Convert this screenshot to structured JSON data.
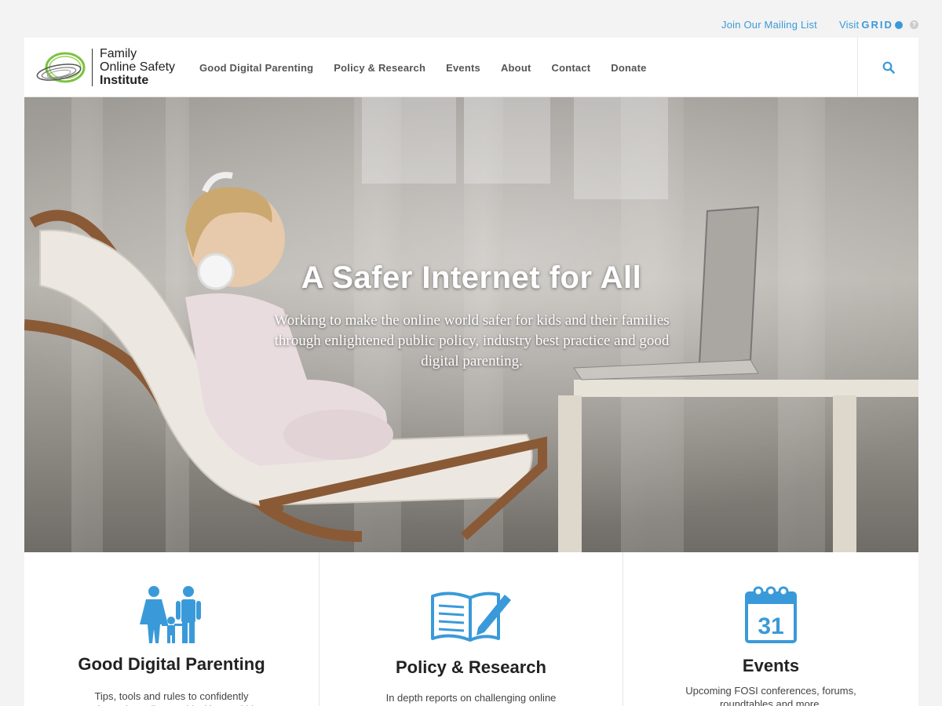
{
  "utility": {
    "mailing_label": "Join Our Mailing List",
    "visit_label": "Visit",
    "grid_label": "GRID",
    "help_label": "?"
  },
  "header": {
    "logo": {
      "line1": "Family",
      "line2": "Online Safety",
      "line3": "Institute"
    },
    "nav": [
      {
        "label": "Good Digital Parenting"
      },
      {
        "label": "Policy & Research"
      },
      {
        "label": "Events"
      },
      {
        "label": "About"
      },
      {
        "label": "Contact"
      },
      {
        "label": "Donate"
      }
    ],
    "search_icon": "search-icon"
  },
  "hero": {
    "title": "A Safer Internet for All",
    "subtitle": "Working to make the online world safer for kids and their families through enlightened public policy, industry best practice and good digital parenting."
  },
  "cards": [
    {
      "icon": "family-icon",
      "title": "Good Digital Parenting",
      "description": "Tips, tools and rules to confidently navigate the online world with your kids."
    },
    {
      "icon": "open-book-pencil-icon",
      "title": "Policy & Research",
      "description": "In depth reports on challenging online safety issues, laws and regulations."
    },
    {
      "icon": "calendar-icon",
      "title": "Events",
      "calendar_day": "31",
      "description": "Upcoming FOSI conferences, forums, roundtables and more."
    }
  ],
  "colors": {
    "accent": "#3a9ad9",
    "logo_green": "#7cc242",
    "header_bg": "#ffffff",
    "page_bg": "#f3f3f3"
  }
}
